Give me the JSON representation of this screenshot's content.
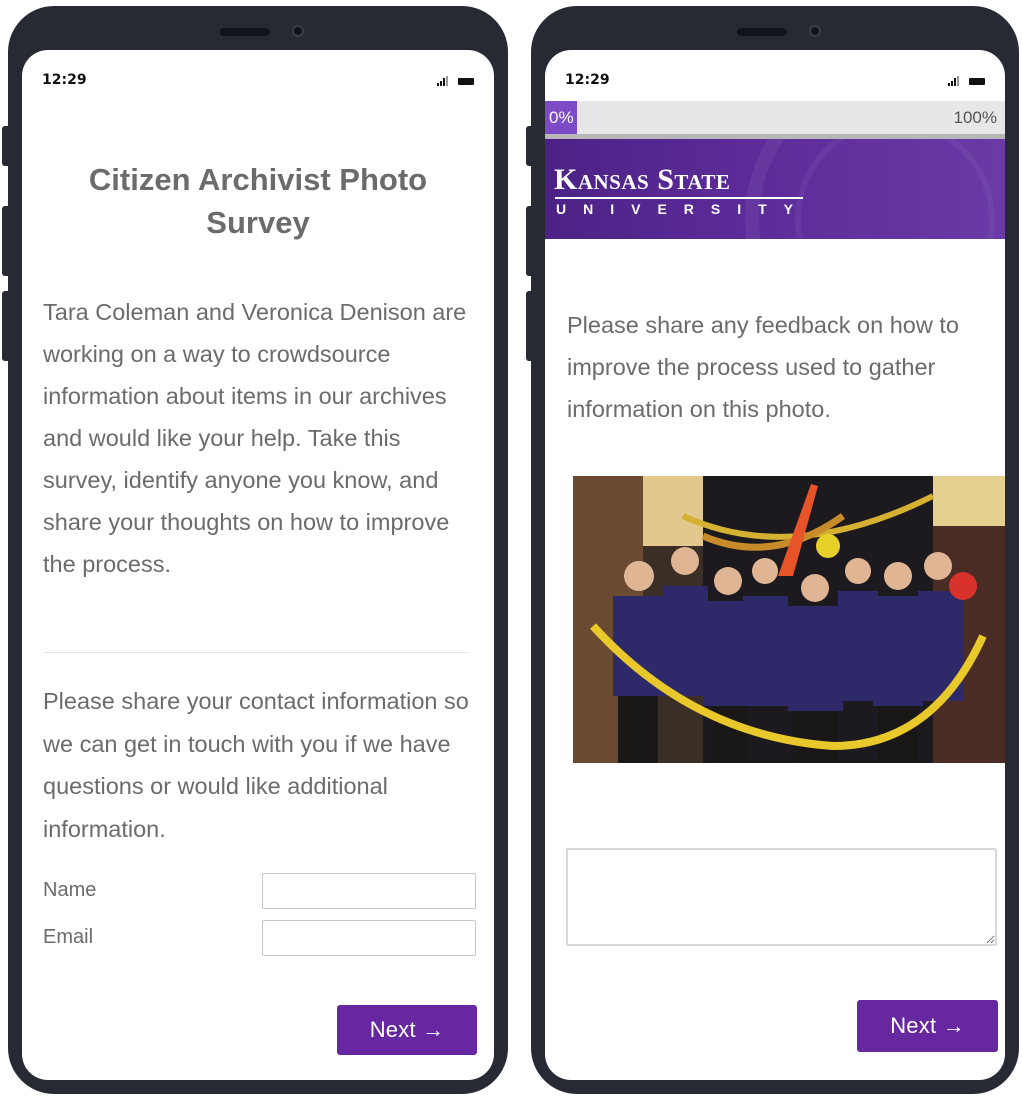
{
  "status_bar": {
    "time": "12:29"
  },
  "intro_screen": {
    "title": "Citizen Archivist Photo Survey",
    "intro_text": "Tara Coleman and Veronica Denison are working on a way to crowdsource information about items in our archives and would like your help. Take this survey, identify anyone you know, and share your thoughts on how to improve the process.",
    "contact_prompt": "Please share your contact information so we can get in touch with you if we have questions or would like additional information.",
    "fields": [
      {
        "label": "Name",
        "value": ""
      },
      {
        "label": "Email",
        "value": ""
      }
    ],
    "next_button": "Next →"
  },
  "feedback_screen": {
    "progress": {
      "start_label": "0%",
      "end_label": "100%",
      "fraction": 0.07
    },
    "logo": {
      "line1": "Kansas State",
      "line2": "UNIVERSITY"
    },
    "question": "Please share any feedback on how to improve the process used to gather information on this photo.",
    "feedback_value": "",
    "next_button": "Next →"
  },
  "colors": {
    "accent": "#6627a1",
    "brand_purple": "#512888",
    "text": "#6b6b6b",
    "frame": "#272a33"
  },
  "icons": [
    "signal-icon",
    "battery-icon",
    "resize-grip-icon",
    "arrow-right-icon"
  ]
}
